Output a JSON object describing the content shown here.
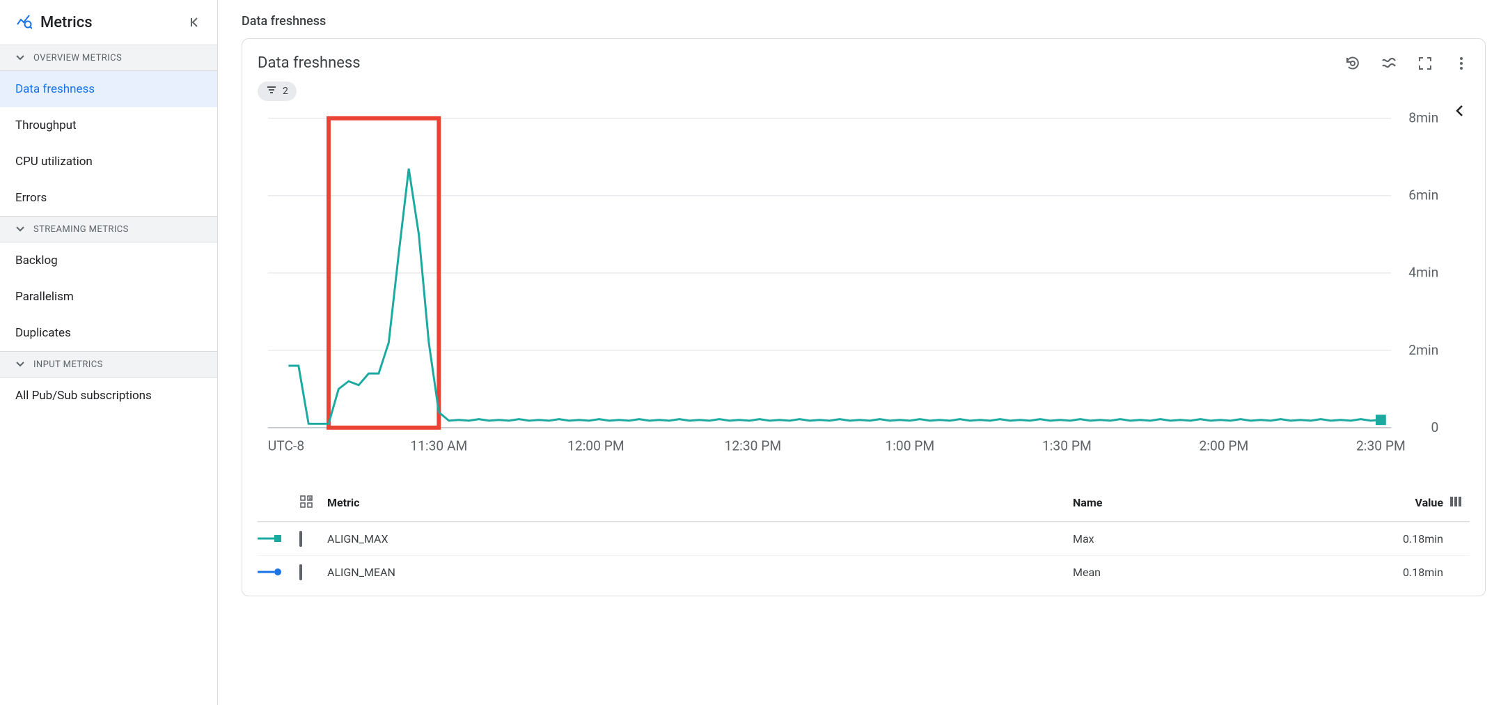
{
  "sidebar": {
    "title": "Metrics",
    "sections": [
      {
        "label": "OVERVIEW METRICS",
        "items": [
          {
            "label": "Data freshness",
            "active": true
          },
          {
            "label": "Throughput"
          },
          {
            "label": "CPU utilization"
          },
          {
            "label": "Errors"
          }
        ]
      },
      {
        "label": "STREAMING METRICS",
        "items": [
          {
            "label": "Backlog"
          },
          {
            "label": "Parallelism"
          },
          {
            "label": "Duplicates"
          }
        ]
      },
      {
        "label": "INPUT METRICS",
        "items": [
          {
            "label": "All Pub/Sub subscriptions"
          }
        ]
      }
    ]
  },
  "page": {
    "heading": "Data freshness",
    "card_title": "Data freshness",
    "filter_count": "2"
  },
  "chart_data": {
    "type": "line",
    "title": "Data freshness",
    "xlabel": "",
    "ylabel": "",
    "x_axis": {
      "timezone_label": "UTC-8",
      "ticks": [
        "11:30 AM",
        "12:00 PM",
        "12:30 PM",
        "1:00 PM",
        "1:30 PM",
        "2:00 PM",
        "2:30 PM"
      ]
    },
    "y_axis": {
      "ticks": [
        "0",
        "2min",
        "4min",
        "6min",
        "8min"
      ],
      "min": 0,
      "max": 8
    },
    "highlight_window": {
      "x_start": "11:05 AM",
      "x_end": "11:28 AM"
    },
    "series": [
      {
        "name": "ALIGN_MAX",
        "color": "#1ba9a0",
        "x_start": "11:00 AM",
        "values_minutes": [
          1.6,
          1.6,
          0.1,
          0.1,
          0.1,
          1.0,
          1.2,
          1.1,
          1.4,
          1.4,
          2.2,
          4.5,
          6.7,
          5.0,
          2.2,
          0.4,
          0.18,
          0.2,
          0.18,
          0.22,
          0.18,
          0.2,
          0.18,
          0.22,
          0.18,
          0.2,
          0.18,
          0.22,
          0.18,
          0.2,
          0.18,
          0.22,
          0.18,
          0.2,
          0.18,
          0.22,
          0.18,
          0.2,
          0.18,
          0.22,
          0.18,
          0.2,
          0.18,
          0.22,
          0.18,
          0.2,
          0.18,
          0.22,
          0.18,
          0.2,
          0.18,
          0.22,
          0.18,
          0.2,
          0.18,
          0.22,
          0.18,
          0.2,
          0.18,
          0.22,
          0.18,
          0.2,
          0.18,
          0.22,
          0.18,
          0.2,
          0.18,
          0.22,
          0.18,
          0.2,
          0.18,
          0.22,
          0.18,
          0.2,
          0.18,
          0.22,
          0.18,
          0.2,
          0.18,
          0.22,
          0.18,
          0.2,
          0.18,
          0.22,
          0.18,
          0.2,
          0.18,
          0.22,
          0.18,
          0.2,
          0.18,
          0.22,
          0.18,
          0.2,
          0.18,
          0.22,
          0.18,
          0.2,
          0.18,
          0.22,
          0.18,
          0.2,
          0.18,
          0.22,
          0.18,
          0.2,
          0.18,
          0.22,
          0.18,
          0.2
        ]
      }
    ],
    "end_marker": {
      "color": "#1ba9a0"
    }
  },
  "table": {
    "headers": {
      "metric": "Metric",
      "name": "Name",
      "value": "Value"
    },
    "rows": [
      {
        "legend_type": "square",
        "legend_color": "#1ba9a0",
        "metric": "ALIGN_MAX",
        "name": "Max",
        "value": "0.18min"
      },
      {
        "legend_type": "circle",
        "legend_color": "#1a73e8",
        "metric": "ALIGN_MEAN",
        "name": "Mean",
        "value": "0.18min"
      }
    ]
  }
}
